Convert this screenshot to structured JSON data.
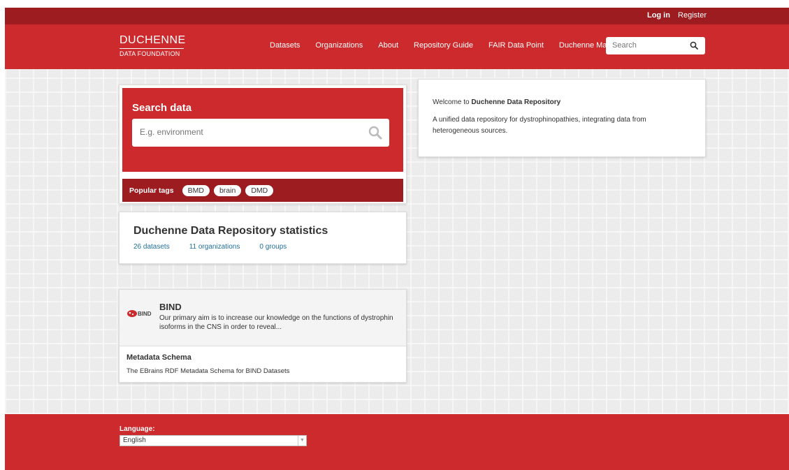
{
  "account": {
    "login": "Log in",
    "register": "Register"
  },
  "logo": {
    "line1": "DUCHENNE",
    "line2": "DATA FOUNDATION"
  },
  "nav": {
    "datasets": "Datasets",
    "organizations": "Organizations",
    "about": "About",
    "repository_guide": "Repository Guide",
    "fair_data_point": "FAIR Data Point",
    "duchenne_map": "Duchenne Map"
  },
  "header_search": {
    "placeholder": "Search"
  },
  "search_card": {
    "title": "Search data",
    "placeholder": "E.g. environment",
    "popular_tags_label": "Popular tags",
    "tags": [
      "BMD",
      "brain",
      "DMD"
    ]
  },
  "welcome": {
    "prefix": "Welcome to",
    "site_name": "Duchenne Data Repository",
    "description": "A unified data repository for dystrophinopathies, integrating data from heterogeneous sources."
  },
  "stats": {
    "title": "Duchenne Data Repository statistics",
    "datasets": "26 datasets",
    "organizations": "11 organizations",
    "groups": "0 groups"
  },
  "featured": {
    "logo_text": "BIND",
    "title": "BIND",
    "description": "Our primary aim is to increase our knowledge on the functions of dystrophin isoforms in the CNS in order to reveal...",
    "sub_title": "Metadata Schema",
    "sub_description": "The EBrains RDF Metadata Schema for BIND Datasets"
  },
  "footer": {
    "language_label": "Language:",
    "language_value": "English"
  },
  "colors": {
    "brand_red": "#cc2a2d",
    "dark_red": "#9c1c1f",
    "link_blue": "#1f6e9a"
  },
  "icons": {
    "search": "search-icon",
    "dropdown": "chevron-down-icon"
  }
}
